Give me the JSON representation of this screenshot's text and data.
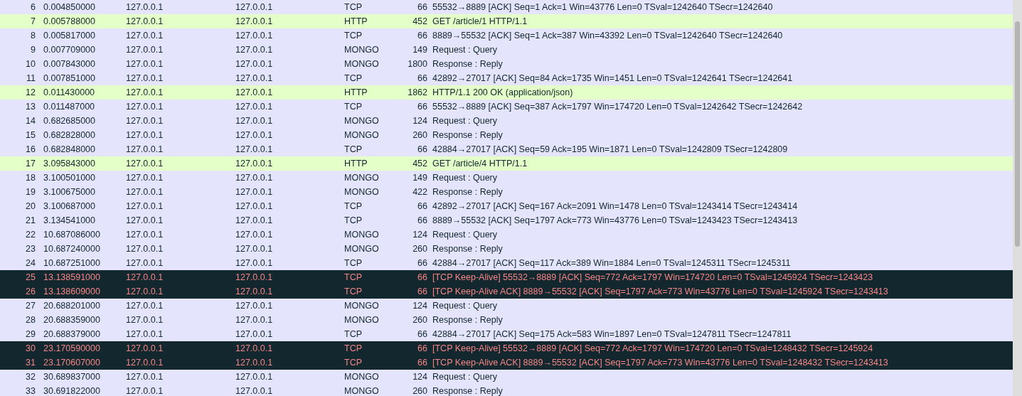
{
  "packets": [
    {
      "no": "6",
      "time": "0.004850000",
      "source": "127.0.0.1",
      "destination": "127.0.0.1",
      "protocol": "TCP",
      "length": "66",
      "info": "55532→8889 [ACK] Seq=1 Ack=1 Win=43776 Len=0 TSval=1242640 TSecr=1242640",
      "kind": "normal"
    },
    {
      "no": "7",
      "time": "0.005788000",
      "source": "127.0.0.1",
      "destination": "127.0.0.1",
      "protocol": "HTTP",
      "length": "452",
      "info": "GET /article/1 HTTP/1.1",
      "kind": "http"
    },
    {
      "no": "8",
      "time": "0.005817000",
      "source": "127.0.0.1",
      "destination": "127.0.0.1",
      "protocol": "TCP",
      "length": "66",
      "info": "8889→55532 [ACK] Seq=1 Ack=387 Win=43392 Len=0 TSval=1242640 TSecr=1242640",
      "kind": "normal"
    },
    {
      "no": "9",
      "time": "0.007709000",
      "source": "127.0.0.1",
      "destination": "127.0.0.1",
      "protocol": "MONGO",
      "length": "149",
      "info": "Request : Query",
      "kind": "normal"
    },
    {
      "no": "10",
      "time": "0.007843000",
      "source": "127.0.0.1",
      "destination": "127.0.0.1",
      "protocol": "MONGO",
      "length": "1800",
      "info": "Response : Reply",
      "kind": "normal"
    },
    {
      "no": "11",
      "time": "0.007851000",
      "source": "127.0.0.1",
      "destination": "127.0.0.1",
      "protocol": "TCP",
      "length": "66",
      "info": "42892→27017 [ACK] Seq=84 Ack=1735 Win=1451 Len=0 TSval=1242641 TSecr=1242641",
      "kind": "normal"
    },
    {
      "no": "12",
      "time": "0.011430000",
      "source": "127.0.0.1",
      "destination": "127.0.0.1",
      "protocol": "HTTP",
      "length": "1862",
      "info": "HTTP/1.1 200 OK  (application/json)",
      "kind": "http"
    },
    {
      "no": "13",
      "time": "0.011487000",
      "source": "127.0.0.1",
      "destination": "127.0.0.1",
      "protocol": "TCP",
      "length": "66",
      "info": "55532→8889 [ACK] Seq=387 Ack=1797 Win=174720 Len=0 TSval=1242642 TSecr=1242642",
      "kind": "normal"
    },
    {
      "no": "14",
      "time": "0.682685000",
      "source": "127.0.0.1",
      "destination": "127.0.0.1",
      "protocol": "MONGO",
      "length": "124",
      "info": "Request : Query",
      "kind": "normal"
    },
    {
      "no": "15",
      "time": "0.682828000",
      "source": "127.0.0.1",
      "destination": "127.0.0.1",
      "protocol": "MONGO",
      "length": "260",
      "info": "Response : Reply",
      "kind": "normal"
    },
    {
      "no": "16",
      "time": "0.682848000",
      "source": "127.0.0.1",
      "destination": "127.0.0.1",
      "protocol": "TCP",
      "length": "66",
      "info": "42884→27017 [ACK] Seq=59 Ack=195 Win=1871 Len=0 TSval=1242809 TSecr=1242809",
      "kind": "normal"
    },
    {
      "no": "17",
      "time": "3.095843000",
      "source": "127.0.0.1",
      "destination": "127.0.0.1",
      "protocol": "HTTP",
      "length": "452",
      "info": "GET /article/4 HTTP/1.1",
      "kind": "http"
    },
    {
      "no": "18",
      "time": "3.100501000",
      "source": "127.0.0.1",
      "destination": "127.0.0.1",
      "protocol": "MONGO",
      "length": "149",
      "info": "Request : Query",
      "kind": "normal"
    },
    {
      "no": "19",
      "time": "3.100675000",
      "source": "127.0.0.1",
      "destination": "127.0.0.1",
      "protocol": "MONGO",
      "length": "422",
      "info": "Response : Reply",
      "kind": "normal"
    },
    {
      "no": "20",
      "time": "3.100687000",
      "source": "127.0.0.1",
      "destination": "127.0.0.1",
      "protocol": "TCP",
      "length": "66",
      "info": "42892→27017 [ACK] Seq=167 Ack=2091 Win=1478 Len=0 TSval=1243414 TSecr=1243414",
      "kind": "normal"
    },
    {
      "no": "21",
      "time": "3.134541000",
      "source": "127.0.0.1",
      "destination": "127.0.0.1",
      "protocol": "TCP",
      "length": "66",
      "info": "8889→55532 [ACK] Seq=1797 Ack=773 Win=43776 Len=0 TSval=1243423 TSecr=1243413",
      "kind": "normal"
    },
    {
      "no": "22",
      "time": "10.687086000",
      "source": "127.0.0.1",
      "destination": "127.0.0.1",
      "protocol": "MONGO",
      "length": "124",
      "info": "Request : Query",
      "kind": "normal"
    },
    {
      "no": "23",
      "time": "10.687240000",
      "source": "127.0.0.1",
      "destination": "127.0.0.1",
      "protocol": "MONGO",
      "length": "260",
      "info": "Response : Reply",
      "kind": "normal"
    },
    {
      "no": "24",
      "time": "10.687251000",
      "source": "127.0.0.1",
      "destination": "127.0.0.1",
      "protocol": "TCP",
      "length": "66",
      "info": "42884→27017 [ACK] Seq=117 Ack=389 Win=1884 Len=0 TSval=1245311 TSecr=1245311",
      "kind": "normal"
    },
    {
      "no": "25",
      "time": "13.138591000",
      "source": "127.0.0.1",
      "destination": "127.0.0.1",
      "protocol": "TCP",
      "length": "66",
      "info": "[TCP Keep-Alive] 55532→8889 [ACK] Seq=772 Ack=1797 Win=174720 Len=0 TSval=1245924 TSecr=1243423",
      "kind": "bad"
    },
    {
      "no": "26",
      "time": "13.138609000",
      "source": "127.0.0.1",
      "destination": "127.0.0.1",
      "protocol": "TCP",
      "length": "66",
      "info": "[TCP Keep-Alive ACK] 8889→55532 [ACK] Seq=1797 Ack=773 Win=43776 Len=0 TSval=1245924 TSecr=1243413",
      "kind": "bad"
    },
    {
      "no": "27",
      "time": "20.688201000",
      "source": "127.0.0.1",
      "destination": "127.0.0.1",
      "protocol": "MONGO",
      "length": "124",
      "info": "Request : Query",
      "kind": "normal"
    },
    {
      "no": "28",
      "time": "20.688359000",
      "source": "127.0.0.1",
      "destination": "127.0.0.1",
      "protocol": "MONGO",
      "length": "260",
      "info": "Response : Reply",
      "kind": "normal"
    },
    {
      "no": "29",
      "time": "20.688379000",
      "source": "127.0.0.1",
      "destination": "127.0.0.1",
      "protocol": "TCP",
      "length": "66",
      "info": "42884→27017 [ACK] Seq=175 Ack=583 Win=1897 Len=0 TSval=1247811 TSecr=1247811",
      "kind": "normal"
    },
    {
      "no": "30",
      "time": "23.170590000",
      "source": "127.0.0.1",
      "destination": "127.0.0.1",
      "protocol": "TCP",
      "length": "66",
      "info": "[TCP Keep-Alive] 55532→8889 [ACK] Seq=772 Ack=1797 Win=174720 Len=0 TSval=1248432 TSecr=1245924",
      "kind": "bad"
    },
    {
      "no": "31",
      "time": "23.170607000",
      "source": "127.0.0.1",
      "destination": "127.0.0.1",
      "protocol": "TCP",
      "length": "66",
      "info": "[TCP Keep-Alive ACK] 8889→55532 [ACK] Seq=1797 Ack=773 Win=43776 Len=0 TSval=1248432 TSecr=1243413",
      "kind": "bad"
    },
    {
      "no": "32",
      "time": "30.689837000",
      "source": "127.0.0.1",
      "destination": "127.0.0.1",
      "protocol": "MONGO",
      "length": "124",
      "info": "Request : Query",
      "kind": "normal"
    },
    {
      "no": "33",
      "time": "30.691822000",
      "source": "127.0.0.1",
      "destination": "127.0.0.1",
      "protocol": "MONGO",
      "length": "260",
      "info": "Response : Reply",
      "kind": "normal"
    }
  ]
}
